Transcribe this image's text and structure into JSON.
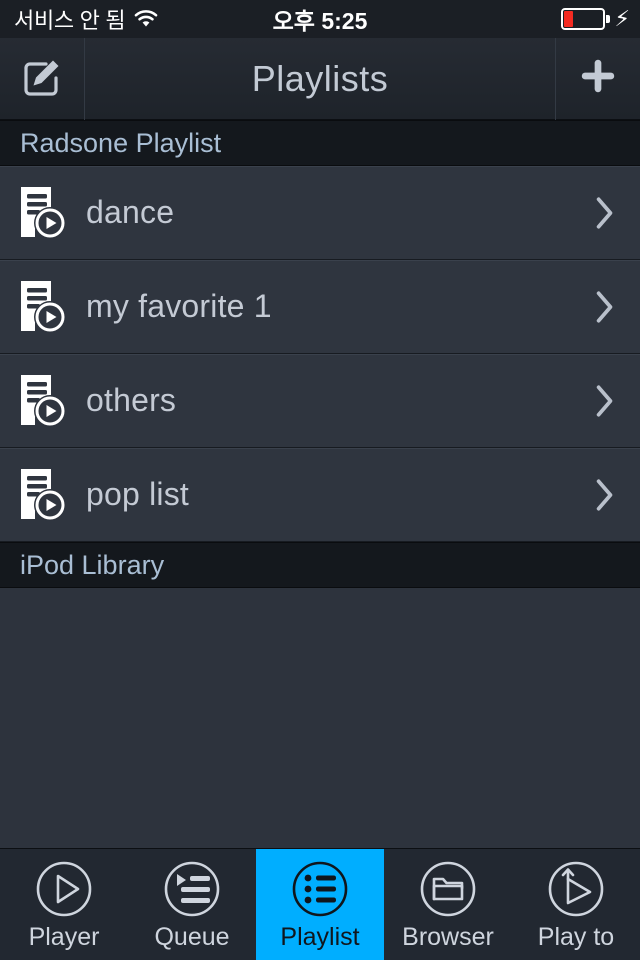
{
  "status_bar": {
    "carrier": "서비스 안 됨",
    "wifi_icon": "wifi-icon",
    "time": "오후 5:25",
    "battery_icon": "battery-low-icon",
    "battery_percent": 22,
    "charging_icon": "lightning-bolt-icon"
  },
  "nav_bar": {
    "edit_icon": "edit-pencil-icon",
    "title": "Playlists",
    "add_icon": "plus-icon"
  },
  "sections": [
    {
      "header": "Radsone Playlist",
      "rows": [
        {
          "icon": "playlist-play-icon",
          "label": "dance",
          "chevron": "chevron-right-icon"
        },
        {
          "icon": "playlist-play-icon",
          "label": "my favorite 1",
          "chevron": "chevron-right-icon"
        },
        {
          "icon": "playlist-play-icon",
          "label": "others",
          "chevron": "chevron-right-icon"
        },
        {
          "icon": "playlist-play-icon",
          "label": "pop list",
          "chevron": "chevron-right-icon"
        }
      ]
    },
    {
      "header": "iPod Library",
      "rows": []
    }
  ],
  "tab_bar": {
    "active_color": "#00aeff",
    "tabs": [
      {
        "icon": "play-circle-icon",
        "label": "Player",
        "active": false
      },
      {
        "icon": "queue-list-icon",
        "label": "Queue",
        "active": false
      },
      {
        "icon": "playlist-list-icon",
        "label": "Playlist",
        "active": true
      },
      {
        "icon": "folder-icon",
        "label": "Browser",
        "active": false
      },
      {
        "icon": "play-to-icon",
        "label": "Play to",
        "active": false
      }
    ]
  }
}
